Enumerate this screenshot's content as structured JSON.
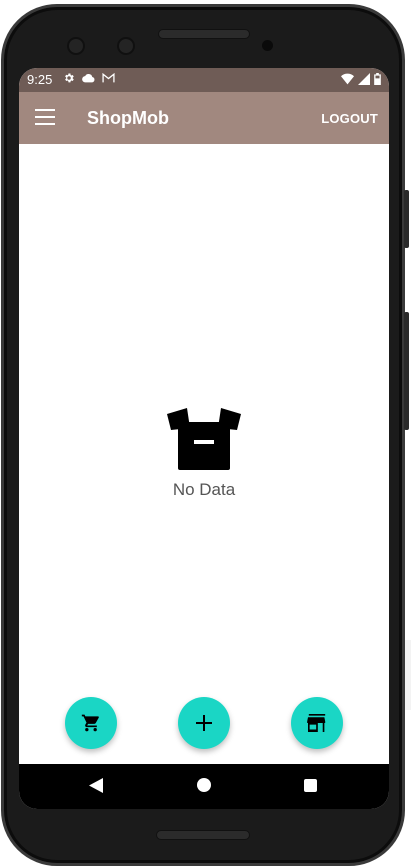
{
  "status_bar": {
    "time": "9:25",
    "left_icons": [
      "gear-icon",
      "cloud-icon",
      "gmail-icon"
    ],
    "right_icons": [
      "wifi-icon",
      "signal-icon",
      "battery-icon"
    ]
  },
  "app_bar": {
    "title": "ShopMob",
    "logout_label": "LOGOUT",
    "background": "#a1887f"
  },
  "empty_state": {
    "icon": "open-box-icon",
    "message": "No Data"
  },
  "fabs": [
    {
      "icon": "cart-icon"
    },
    {
      "icon": "add-icon"
    },
    {
      "icon": "store-icon"
    }
  ],
  "colors": {
    "status_bar": "#6f5c56",
    "accent": "#1ad6c5"
  },
  "nav_bar": {
    "icons": [
      "back-icon",
      "home-icon",
      "recents-icon"
    ]
  }
}
